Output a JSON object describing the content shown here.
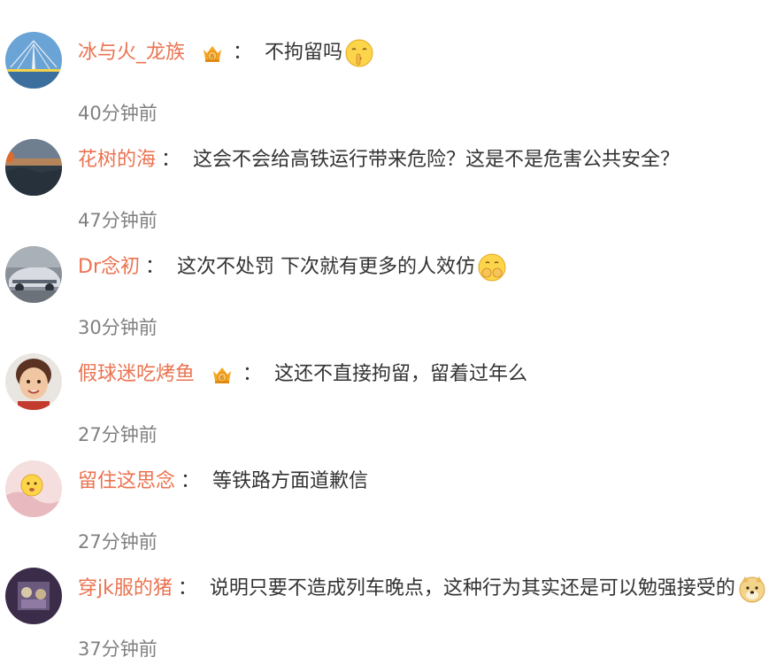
{
  "comments": [
    {
      "username": "冰与火_龙族",
      "vip": true,
      "separator": "：",
      "text": "不拘留吗",
      "emoji": "shush-face-emoji",
      "time": "40分钟前",
      "avatar": "bridge-sky-avatar"
    },
    {
      "username": "花树的海",
      "vip": false,
      "separator": "：",
      "text": "这会不会给高铁运行带来危险？这是不是危害公共安全？",
      "emoji": null,
      "time": "47分钟前",
      "avatar": "sunset-landscape-avatar"
    },
    {
      "username": "Dr念初",
      "vip": false,
      "separator": "：",
      "text": "这次不处罚 下次就有更多的人效仿",
      "emoji": "hands-over-mouth-emoji",
      "time": "30分钟前",
      "avatar": "car-photo-avatar"
    },
    {
      "username": "假球迷吃烤鱼",
      "vip": true,
      "separator": "：",
      "text": "这还不直接拘留，留着过年么",
      "emoji": null,
      "time": "27分钟前",
      "avatar": "child-portrait-avatar"
    },
    {
      "username": "留住这思念",
      "vip": false,
      "separator": "：",
      "text": "等铁路方面道歉信",
      "emoji": null,
      "time": "27分钟前",
      "avatar": "pink-emoji-avatar"
    },
    {
      "username": "穿jk服的猪",
      "vip": false,
      "separator": "：",
      "text": "说明只要不造成列车晚点，这种行为其实还是可以勉强接受的",
      "emoji": "doge-emoji",
      "time": "37分钟前",
      "avatar": "purple-photo-avatar"
    }
  ],
  "colors": {
    "username": "#eb7350",
    "text": "#333333",
    "time": "#808080",
    "background": "#ffffff"
  }
}
